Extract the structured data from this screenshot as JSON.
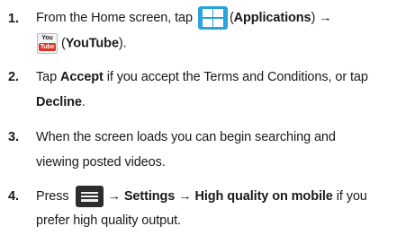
{
  "steps": [
    {
      "number": "1.",
      "line1": {
        "prefix": "From the Home screen, tap",
        "paren_open": "(",
        "apps_bold": "Applications",
        "paren_close": ") →"
      },
      "line2": {
        "paren_open": "(",
        "youtube_bold": "YouTube",
        "paren_close": ")."
      }
    },
    {
      "number": "2.",
      "line1": {
        "prefix": "Tap",
        "accept_bold": "Accept",
        "suffix": "if you accept the Terms and Conditions, or tap"
      },
      "line2": {
        "decline_bold": "Decline",
        "suffix": "."
      }
    },
    {
      "number": "3.",
      "line1": "When the screen loads you can begin searching and",
      "line2": "viewing posted videos."
    },
    {
      "number": "4.",
      "line1": {
        "prefix": "Press",
        "path_bold": "→ Settings → High quality on mobile",
        "suffix": "if you"
      },
      "line2": "prefer high quality output."
    }
  ],
  "icons": {
    "applications": "applications-icon",
    "youtube": "youtube-icon",
    "menu": "menu-key-icon"
  },
  "youtube_icon_text": {
    "top": "You",
    "bottom": "Tube"
  },
  "colors": {
    "applications_icon": "#29a3dd",
    "youtube_red": "#d8332a",
    "menu_icon": "#2d2d2d"
  }
}
